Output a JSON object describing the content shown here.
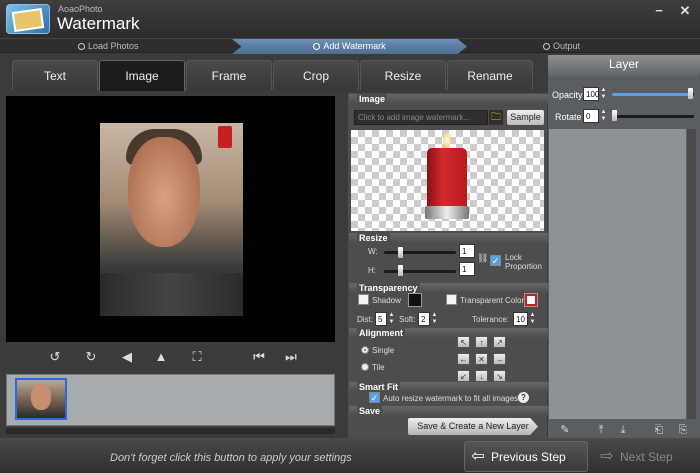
{
  "app": {
    "brand_small": "AoaoPhoto",
    "brand_big": "Watermark",
    "minimize_icon": "minimize-icon",
    "close_icon": "close-icon"
  },
  "steps": [
    "Load Photos",
    "Add Watermark",
    "Output"
  ],
  "active_step": "Add Watermark",
  "tabs": [
    "Text",
    "Image",
    "Frame",
    "Crop",
    "Resize",
    "Rename"
  ],
  "active_tab": "Image",
  "image_section": {
    "title": "Image",
    "placeholder": "Click to add image watermark...",
    "sample_label": "Sample"
  },
  "resize": {
    "title": "Resize",
    "w_label": "W:",
    "h_label": "H:",
    "w_value": "1",
    "h_value": "1",
    "lock_label": "Lock Proportion",
    "lock_checked": true
  },
  "transparency": {
    "title": "Transparency",
    "shadow_label": "Shadow",
    "shadow_checked": false,
    "transparent_color_label": "Transparent Color",
    "transparent_checked": false,
    "dist_label": "Dist:",
    "dist_value": "5",
    "soft_label": "Soft:",
    "soft_value": "2",
    "tolerance_label": "Tolerance:",
    "tolerance_value": "10"
  },
  "alignment": {
    "title": "Alignment",
    "single_label": "Single",
    "tile_label": "Tile",
    "selected": "Single"
  },
  "smart_fit": {
    "title": "Smart Fit",
    "label": "Auto resize watermark to fit all images.",
    "checked": true
  },
  "save": {
    "title": "Save",
    "button_label": "Save & Create a New Layer"
  },
  "layer": {
    "title": "Layer",
    "opacity_label": "Opacity",
    "opacity_value": "100",
    "rotate_label": "Rotate",
    "rotate_value": "0"
  },
  "bottom": {
    "hint": "Don't forget click this button to apply your settings",
    "prev_label": "Previous Step",
    "next_label": "Next Step"
  },
  "colors": {
    "accent": "#5aa0e6",
    "step_active": "#5a7ca3",
    "candle": "#c81e22"
  }
}
